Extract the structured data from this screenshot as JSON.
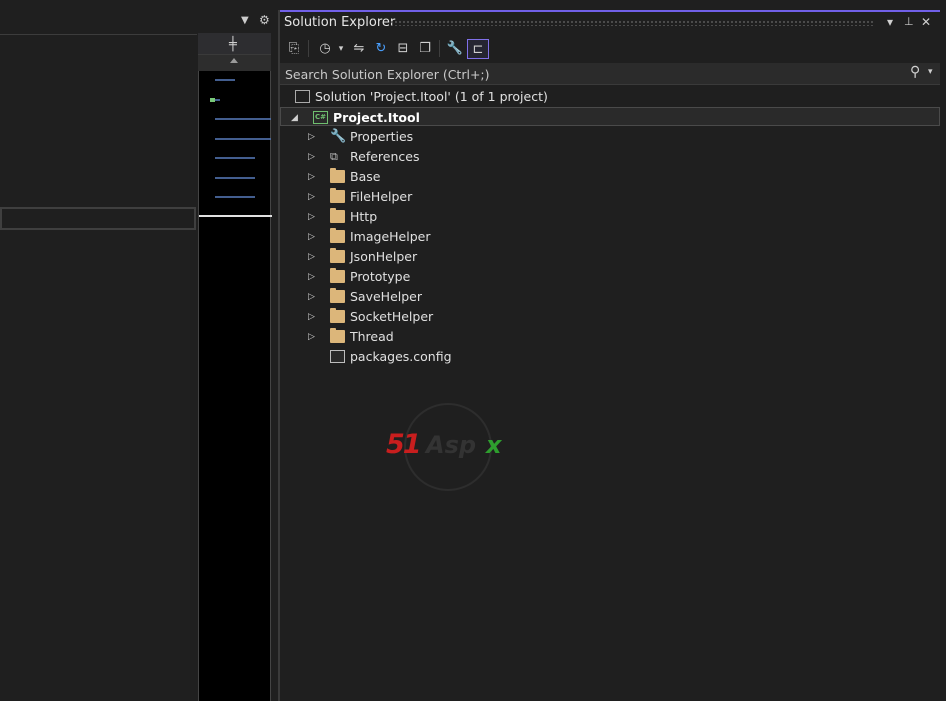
{
  "panel": {
    "title": "Solution Explorer",
    "title_buttons": [
      "▾",
      "📌",
      "✕"
    ]
  },
  "search": {
    "placeholder": "Search Solution Explorer (Ctrl+;)"
  },
  "solution": {
    "label": "Solution 'Project.Itool' (1 of 1 project)"
  },
  "project": {
    "label": "Project.Itool",
    "badge": "C#"
  },
  "items": [
    {
      "label": "Properties",
      "icon": "wrench-icon"
    },
    {
      "label": "References",
      "icon": "references-icon"
    },
    {
      "label": "Base",
      "icon": "folder-icon"
    },
    {
      "label": "FileHelper",
      "icon": "folder-icon"
    },
    {
      "label": "Http",
      "icon": "folder-icon"
    },
    {
      "label": "ImageHelper",
      "icon": "folder-icon"
    },
    {
      "label": "JsonHelper",
      "icon": "folder-icon"
    },
    {
      "label": "Prototype",
      "icon": "folder-icon"
    },
    {
      "label": "SaveHelper",
      "icon": "folder-icon"
    },
    {
      "label": "SocketHelper",
      "icon": "folder-icon"
    },
    {
      "label": "Thread",
      "icon": "folder-icon"
    },
    {
      "label": "packages.config",
      "icon": "config-file-icon"
    }
  ],
  "watermark": {
    "brand_number": "51",
    "brand_text": "Asp",
    "brand_x": "x"
  },
  "colors": {
    "accent": "#7160e8",
    "folder": "#dcb67a",
    "csharp": "#6fbf6f"
  }
}
